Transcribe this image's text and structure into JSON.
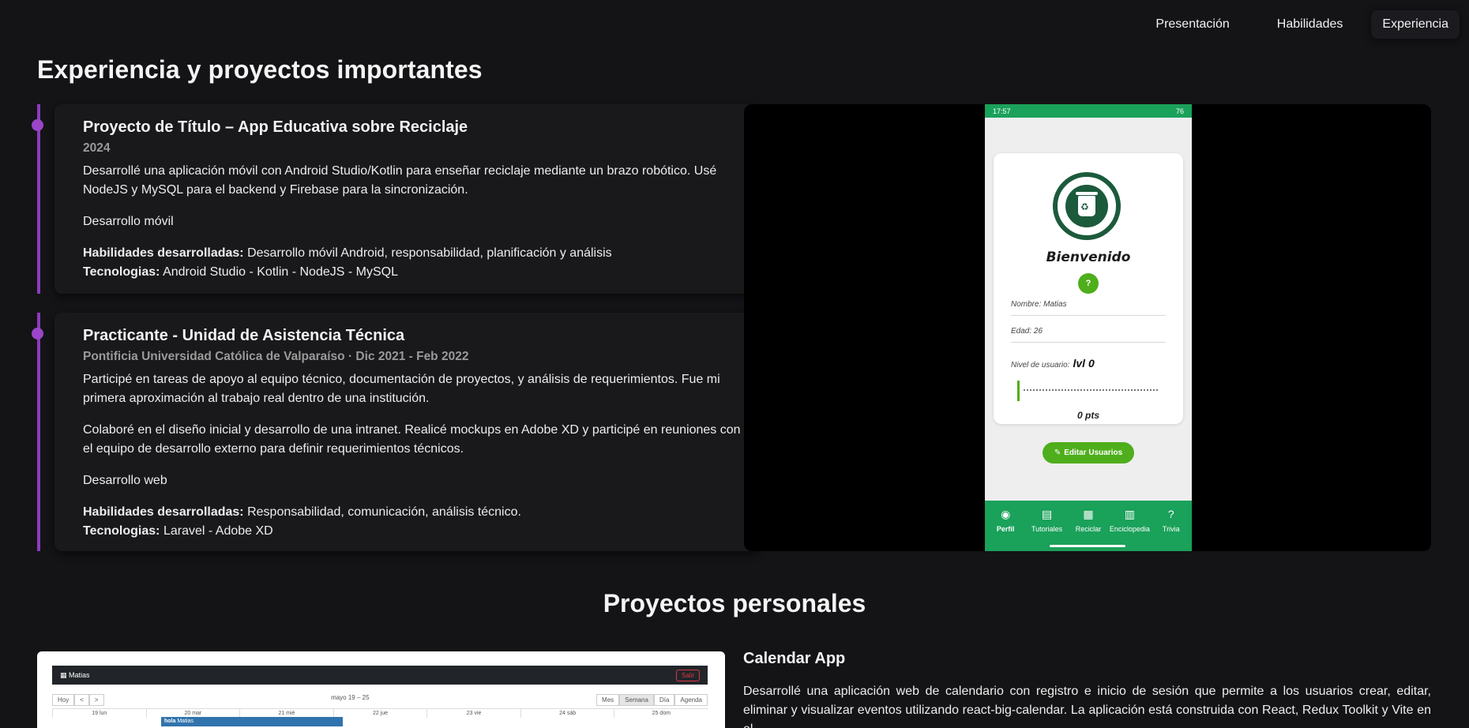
{
  "nav": {
    "items": [
      {
        "label": "Presentación",
        "active": false
      },
      {
        "label": "Habilidades",
        "active": false
      },
      {
        "label": "Experiencia",
        "active": true
      }
    ]
  },
  "experience": {
    "title": "Experiencia y proyectos importantes",
    "accent_color": "#8c3bbf",
    "items": [
      {
        "title": "Proyecto de Título – App Educativa sobre Reciclaje",
        "subtitle": "2024",
        "description": "Desarrollé una aplicación móvil con Android Studio/Kotlin para enseñar reciclaje mediante un brazo robótico. Usé NodeJS y MySQL para el backend y Firebase para la sincronización.",
        "category": "Desarrollo móvil",
        "skills_label": "Habilidades desarrolladas:",
        "skills": "Desarrollo móvil Android, responsabilidad, planificación y análisis",
        "tech_label": "Tecnologias:",
        "tech": "Android Studio - Kotlin - NodeJS - MySQL"
      },
      {
        "title": "Practicante - Unidad de Asistencia Técnica",
        "subtitle": "Pontificia Universidad Católica de Valparaíso · Dic 2021 - Feb 2022",
        "description": "Participé en tareas de apoyo al equipo técnico, documentación de proyectos, y análisis de requerimientos. Fue mi primera aproximación al trabajo real dentro de una institución.",
        "description2": "Colaboré en el diseño inicial y desarrollo de una intranet. Realicé mockups en Adobe XD y participé en reuniones con el equipo de desarrollo externo para definir requerimientos técnicos.",
        "category": "Desarrollo web",
        "skills_label": "Habilidades desarrolladas:",
        "skills": "Responsabilidad, comunicación, análisis técnico.",
        "tech_label": "Tecnologias:",
        "tech": "Laravel - Adobe XD"
      }
    ]
  },
  "phone_demo": {
    "status_time": "17:57",
    "status_battery": "76",
    "welcome": "Bienvenido",
    "name_field": "Nombre: Matias",
    "age_field": "Edad: 26",
    "level_label": "Nivel de usuario:",
    "level_value": "lvl 0",
    "points": "0 pts",
    "edit_button": "Editar Usuarios",
    "bottom_nav": [
      "Perfil",
      "Tutoriales",
      "Reciclar",
      "Enciclopedia",
      "Trivia"
    ],
    "primary_color": "#1aa15a",
    "button_color": "#4fae1c"
  },
  "personal": {
    "title": "Proyectos personales",
    "projects": [
      {
        "name": "Calendar App",
        "description": "Desarrollé una aplicación web de calendario con registro e inicio de sesión que permite a los usuarios crear, editar, eliminar y visualizar eventos utilizando react-big-calendar. La aplicación está construida con React, Redux Toolkit y Vite en el",
        "thumb": {
          "user": "Matias",
          "logout": "Salir",
          "nav_buttons": [
            "Hoy",
            "<",
            ">"
          ],
          "range": "mayo 19 – 25",
          "views": [
            "Mes",
            "Semana",
            "Día",
            "Agenda"
          ],
          "active_view": "Semana",
          "days": [
            "19 lun",
            "20 mar",
            "21 mié",
            "22 jue",
            "23 vie",
            "24 sáb",
            "25 dom"
          ],
          "event_title": "hola",
          "event_user": "Matias"
        }
      }
    ]
  }
}
